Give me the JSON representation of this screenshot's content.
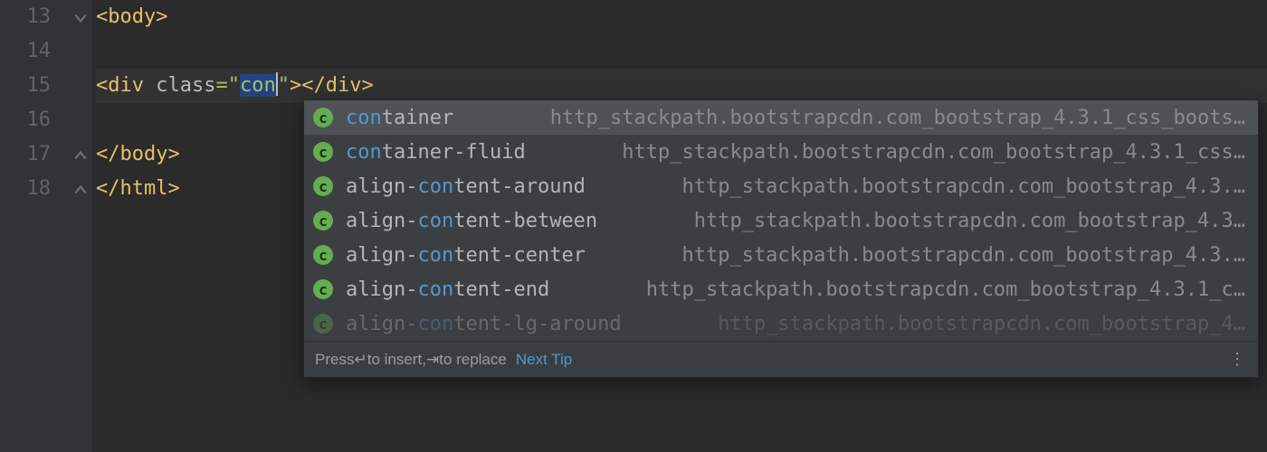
{
  "gutter": [
    "13",
    "14",
    "15",
    "16",
    "17",
    "18"
  ],
  "code": {
    "l13": {
      "open": "<body>",
      "close": ""
    },
    "l15": {
      "prefix": "<div ",
      "attr": "class",
      "eq": "=",
      "q": "\"",
      "typed": "con",
      "rest": "\"></div>"
    },
    "l17": "</body>",
    "l18": "</html>"
  },
  "completion": {
    "items": [
      {
        "pre": "con",
        "post": "tainer",
        "tail": "http_stackpath.bootstrapcdn.com_bootstrap_4.3.1_css_boots…",
        "selected": true
      },
      {
        "pre": "con",
        "post": "tainer-fluid",
        "tail": "http_stackpath.bootstrapcdn.com_bootstrap_4.3.1_css…"
      },
      {
        "pre": "align-",
        "mid": "con",
        "post": "tent-around",
        "tail": "http_stackpath.bootstrapcdn.com_bootstrap_4.3.…"
      },
      {
        "pre": "align-",
        "mid": "con",
        "post": "tent-between",
        "tail": "http_stackpath.bootstrapcdn.com_bootstrap_4.3…"
      },
      {
        "pre": "align-",
        "mid": "con",
        "post": "tent-center",
        "tail": "http_stackpath.bootstrapcdn.com_bootstrap_4.3.…"
      },
      {
        "pre": "align-",
        "mid": "con",
        "post": "tent-end",
        "tail": "http_stackpath.bootstrapcdn.com_bootstrap_4.3.1_c…"
      },
      {
        "pre": "align-",
        "mid": "con",
        "post": "tent-lg-around",
        "tail": "http_stackpath.bootstrapcdn.com_bootstrap_4…",
        "faded": true
      }
    ],
    "footer_press": "Press ",
    "footer_insert": " to insert, ",
    "footer_replace": " to replace",
    "footer_next": "Next Tip",
    "glyph_enter": "↵",
    "glyph_tab": "→|",
    "glyph_tab2": "⇥",
    "badge": "c"
  }
}
